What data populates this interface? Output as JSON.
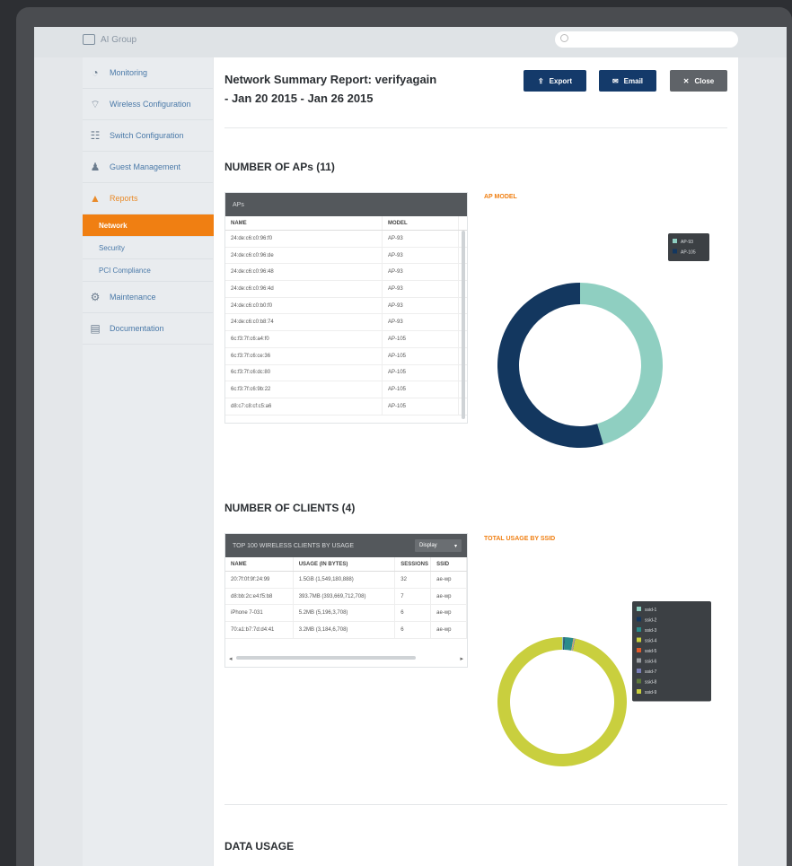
{
  "app": {
    "brand": "AI Group"
  },
  "search": {
    "placeholder": ""
  },
  "sidebar": {
    "items": [
      {
        "label": "Monitoring",
        "icon": "dashboard-icon",
        "glyph": "◔"
      },
      {
        "label": "Wireless Configuration",
        "icon": "wifi-icon",
        "glyph": "⌔"
      },
      {
        "label": "Switch Configuration",
        "icon": "switch-icon",
        "glyph": "☷"
      },
      {
        "label": "Guest Management",
        "icon": "users-icon",
        "glyph": "♟"
      },
      {
        "label": "Reports",
        "icon": "reports-icon",
        "glyph": "▲"
      }
    ],
    "subitems": [
      {
        "label": "Network",
        "active": true
      },
      {
        "label": "Security",
        "active": false
      },
      {
        "label": "PCI Compliance",
        "active": false
      }
    ],
    "items_after": [
      {
        "label": "Maintenance",
        "icon": "wrench-icon",
        "glyph": "⚙"
      },
      {
        "label": "Documentation",
        "icon": "document-icon",
        "glyph": "▤"
      }
    ]
  },
  "header": {
    "title_line1": "Network Summary Report: verifyagain",
    "title_line2": "- Jan 20 2015 - Jan 26 2015",
    "export_label": "Export",
    "email_label": "Email",
    "close_label": "Close"
  },
  "aps": {
    "section_title": "NUMBER OF APs (11)",
    "table_title": "APs",
    "columns": [
      "NAME",
      "MODEL"
    ],
    "rows": [
      [
        "24:de:c6:c0:96:f0",
        "AP-93"
      ],
      [
        "24:de:c6:c0:96:de",
        "AP-93"
      ],
      [
        "24:de:c6:c0:96:48",
        "AP-93"
      ],
      [
        "24:de:c6:c0:96:4d",
        "AP-93"
      ],
      [
        "24:de:c6:c0:b0:f0",
        "AP-93"
      ],
      [
        "24:de:c6:c0:b8:74",
        "AP-93"
      ],
      [
        "6c:f3:7f:c6:a4:f0",
        "AP-105"
      ],
      [
        "6c:f3:7f:c6:ce:36",
        "AP-105"
      ],
      [
        "6c:f3:7f:c6:dc:80",
        "AP-105"
      ],
      [
        "6c:f3:7f:c6:9b:22",
        "AP-105"
      ],
      [
        "d8:c7:c8:cf:c5:a6",
        "AP-105"
      ]
    ],
    "chart_title": "AP MODEL"
  },
  "clients": {
    "section_title": "NUMBER OF CLIENTS (4)",
    "table_title": "TOP 100 WIRELESS CLIENTS BY USAGE",
    "dropdown_label": "Display",
    "columns": [
      "NAME",
      "USAGE (IN BYTES)",
      "SESSIONS",
      "SSID"
    ],
    "rows": [
      [
        "20:7f:0f:9f:24:99",
        "1.5GB (1,549,180,888)",
        "32",
        "ae-wp"
      ],
      [
        "d8:bb:2c:e4:f5:b8",
        "393.7MB (393,669,712,708)",
        "7",
        "ae-wp"
      ],
      [
        "iPhone 7-031",
        "5.2MB (5,196,3,708)",
        "6",
        "ae-wp"
      ],
      [
        "70:a1:b7:7d:d4:41",
        "3.2MB (3,184,6,708)",
        "6",
        "ae-wp"
      ]
    ],
    "chart_title": "TOTAL USAGE BY SSID"
  },
  "data_usage": {
    "section_title": "DATA USAGE"
  },
  "chart_data": [
    {
      "type": "pie",
      "title": "AP MODEL",
      "categories": [
        "AP-93",
        "AP-105"
      ],
      "values": [
        5,
        6
      ],
      "colors": [
        "#8fcfc1",
        "#13375f"
      ],
      "legend_placement": "top-right"
    },
    {
      "type": "pie",
      "title": "TOTAL USAGE BY SSID",
      "categories": [
        "ssid-1",
        "ssid-2",
        "ssid-3",
        "ssid-4",
        "ssid-5",
        "ssid-6",
        "ssid-7",
        "ssid-8",
        "ssid-9"
      ],
      "values": [
        0.3,
        0.3,
        2.2,
        0.1,
        0.1,
        0.1,
        0.1,
        0.1,
        96.7
      ],
      "colors": [
        "#8fcfc1",
        "#13375f",
        "#2a8b8b",
        "#c9cf3e",
        "#e05a2b",
        "#9a9ea2",
        "#7a7fb8",
        "#5f7a3a",
        "#c9cf3e"
      ],
      "legend_placement": "top-right"
    }
  ]
}
